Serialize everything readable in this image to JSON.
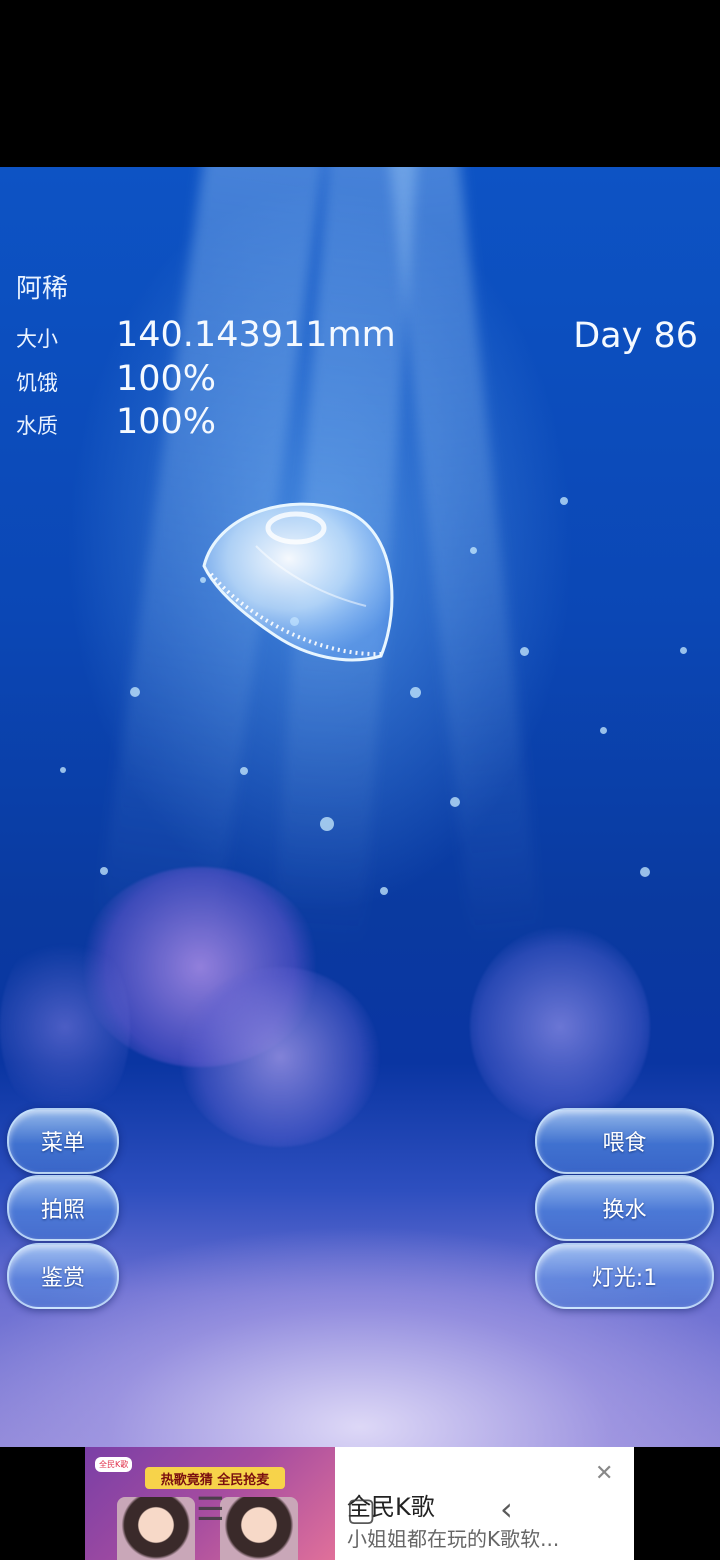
{
  "pet": {
    "name": "阿稀",
    "size_label": "大小",
    "size_value": "140.143911mm",
    "hunger_label": "饥饿",
    "hunger_value": "100%",
    "water_label": "水质",
    "water_value": "100%",
    "day": "Day 86"
  },
  "buttons": {
    "menu": "菜单",
    "photo": "拍照",
    "appreciate": "鉴赏",
    "feed": "喂食",
    "change_water": "换水",
    "light": "灯光:1"
  },
  "ad": {
    "brand_tag": "全民K歌",
    "slogan": "热歌竟猜 全民抢麦",
    "title": "全民K歌",
    "subtitle": "小姐姐都在玩的K歌软...",
    "close_icon": "close-icon"
  },
  "nav": {
    "menu_icon": "☰",
    "home_icon": "▢",
    "back_icon": "‹"
  },
  "colors": {
    "water_top": "#0d53c4",
    "water_deep": "#0a35a2",
    "sand": "#8f87d8"
  }
}
